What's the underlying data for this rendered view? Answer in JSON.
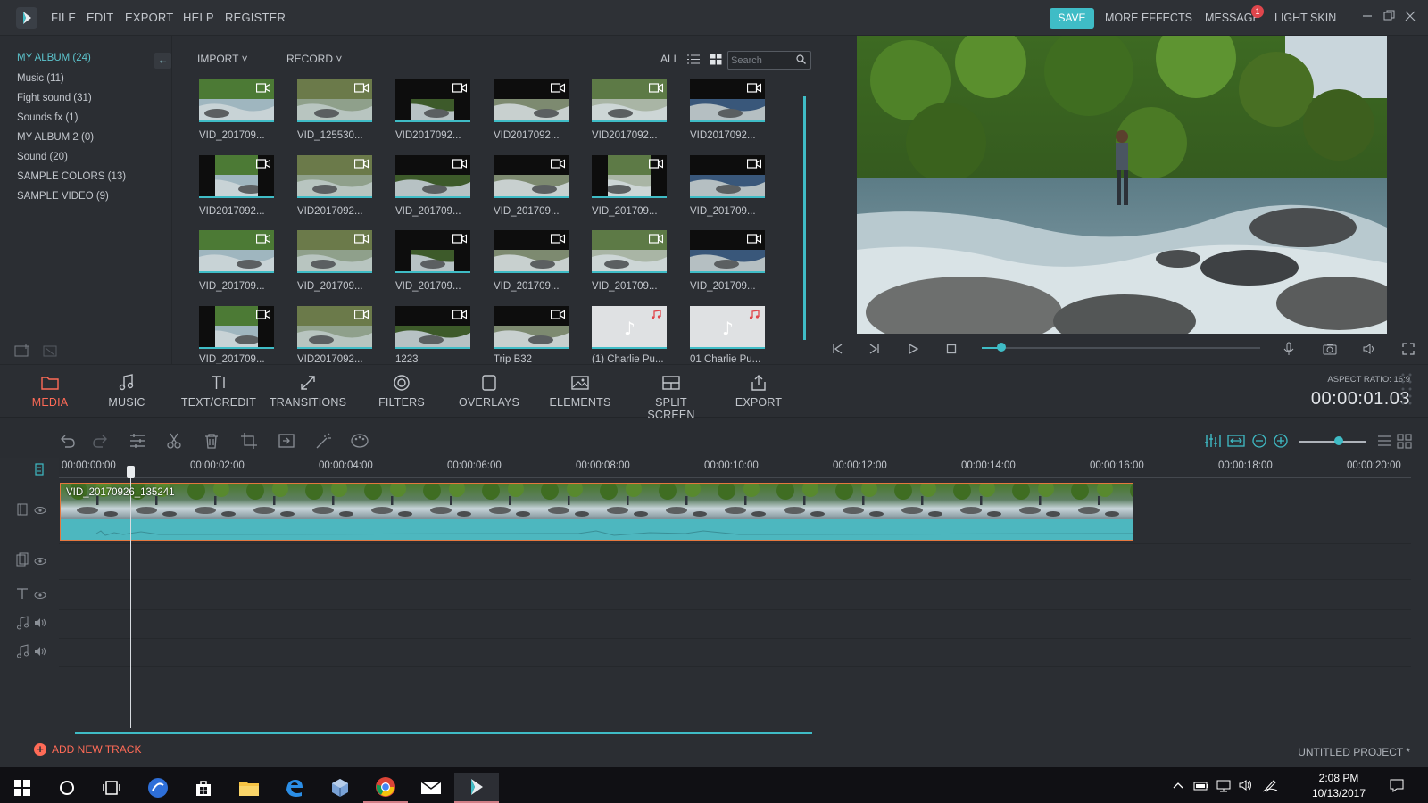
{
  "menu": {
    "items": [
      "FILE",
      "EDIT",
      "EXPORT",
      "HELP",
      "REGISTER"
    ],
    "save_label": "SAVE",
    "more_effects": "MORE EFFECTS",
    "message": "MESSAGE",
    "message_count": "1",
    "light_skin": "LIGHT SKIN"
  },
  "albums": [
    "MY ALBUM (24)",
    "Music (11)",
    "Fight sound (31)",
    "Sounds fx (1)",
    "MY ALBUM 2 (0)",
    "Sound (20)",
    "SAMPLE COLORS (13)",
    "SAMPLE VIDEO (9)"
  ],
  "library": {
    "import": "IMPORT",
    "record": "RECORD",
    "filter": "ALL",
    "search_placeholder": "Search",
    "items": [
      "VID_201709...",
      "VID_125530...",
      "VID2017092...",
      "VID2017092...",
      "VID2017092...",
      "VID2017092...",
      "VID2017092...",
      "VID2017092...",
      "VID_201709...",
      "VID_201709...",
      "VID_201709...",
      "VID_201709...",
      "VID_201709...",
      "VID_201709...",
      "VID_201709...",
      "VID_201709...",
      "VID_201709...",
      "VID_201709...",
      "VID_201709...",
      "VID2017092...",
      "1223",
      "Trip B32",
      "(1) Charlie Pu...",
      "01 Charlie Pu..."
    ]
  },
  "toolbar": [
    {
      "label": "MEDIA",
      "icon": "folder-icon"
    },
    {
      "label": "MUSIC",
      "icon": "music-note-icon"
    },
    {
      "label": "TEXT/CREDIT",
      "icon": "text-icon"
    },
    {
      "label": "TRANSITIONS",
      "icon": "transitions-icon"
    },
    {
      "label": "FILTERS",
      "icon": "filters-icon"
    },
    {
      "label": "OVERLAYS",
      "icon": "overlays-icon"
    },
    {
      "label": "ELEMENTS",
      "icon": "elements-icon"
    },
    {
      "label": "SPLIT SCREEN",
      "icon": "split-screen-icon"
    },
    {
      "label": "EXPORT",
      "icon": "export-icon"
    }
  ],
  "preview": {
    "aspect_ratio": "ASPECT RATIO: 16:9",
    "timecode": "00:00:01.03",
    "progress": 0.07
  },
  "timeline": {
    "ticks": [
      "00:00:00:00",
      "00:00:02:00",
      "00:00:04:00",
      "00:00:06:00",
      "00:00:08:00",
      "00:00:10:00",
      "00:00:12:00",
      "00:00:14:00",
      "00:00:16:00",
      "00:00:18:00",
      "00:00:20:00"
    ],
    "clip_label": "VID_20170926_135241",
    "add_track": "ADD NEW TRACK",
    "project_name": "UNTITLED PROJECT *",
    "zoom_level": 0.6
  },
  "taskbar": {
    "time": "2:08 PM",
    "date": "10/13/2017"
  },
  "colors": {
    "accent": "#3fbcc6",
    "active": "#ff6b57",
    "clip_border": "#e4773e"
  }
}
